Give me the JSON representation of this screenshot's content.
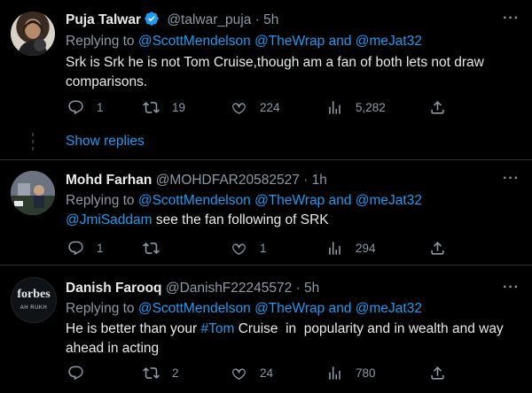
{
  "tweets": [
    {
      "name": "Puja Talwar",
      "verified": true,
      "handle": "@talwar_puja",
      "time": "· 5h",
      "replying_prefix": "Replying to ",
      "replying_users": [
        "@ScottMendelson",
        "@TheWrap",
        "and",
        "@meJat32"
      ],
      "text": "Srk is Srk he is not Tom Cruise,though am a fan of both lets not draw comparisons.",
      "stats": {
        "replies": "1",
        "retweets": "19",
        "likes": "224",
        "views": "5,282"
      },
      "show_replies": "Show replies"
    },
    {
      "name": "Mohd Farhan",
      "handle": "@MOHDFAR20582527",
      "time": "· 1h",
      "replying_prefix": "Replying to ",
      "replying_users": [
        "@ScottMendelson",
        "@TheWrap",
        "and",
        "@meJat32"
      ],
      "mention": "@JmiSaddam",
      "text": " see the fan following of SRK",
      "stats": {
        "replies": "1",
        "retweets": "",
        "likes": "1",
        "views": "294"
      }
    },
    {
      "name": "Danish Farooq",
      "handle": "@DanishF22245572",
      "time": "· 5h",
      "avatar_text": "forbes",
      "avatar_subtext": "AH RUKH",
      "replying_prefix": "Replying to ",
      "replying_users": [
        "@ScottMendelson",
        "@TheWrap",
        "and",
        "@meJat32"
      ],
      "text_before": "He is better than your ",
      "hashtag": "#Tom",
      "text_after": " Cruise  in  popularity and in wealth and way ahead in acting",
      "stats": {
        "replies": "",
        "retweets": "2",
        "likes": "24",
        "views": "780"
      }
    }
  ],
  "colors": {
    "background": "#000000",
    "text": "#e7e9ea",
    "muted": "#8b98a5",
    "accent": "#1d9bf0",
    "divider": "#2f3336"
  },
  "icons": [
    "reply-icon",
    "retweet-icon",
    "like-icon",
    "views-icon",
    "share-icon",
    "more-icon",
    "verified-icon"
  ]
}
